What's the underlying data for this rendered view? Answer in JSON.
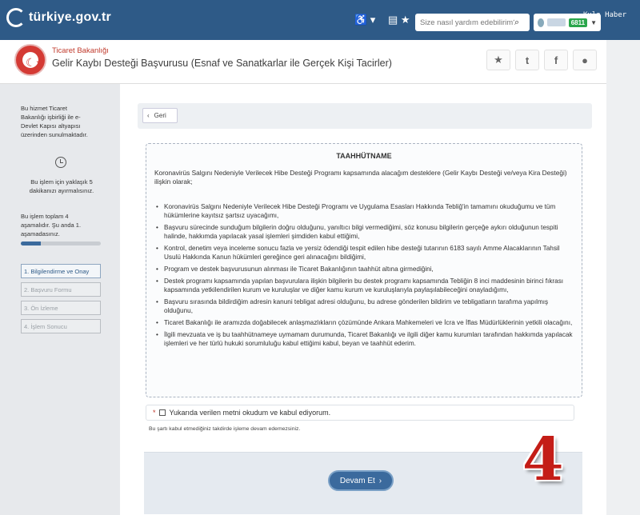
{
  "topbar": {
    "logo_text": "türkiye.gov.tr",
    "search_placeholder": "Size nasıl yardım edebilirim?",
    "user_badge": "6811",
    "watermark": "Kula Haber"
  },
  "service": {
    "department": "Ticaret Bakanlığı",
    "title": "Gelir Kaybı Desteği Başvurusu (Esnaf ve Sanatkarlar ile Gerçek Kişi Tacirler)"
  },
  "sidebar": {
    "provider_note": [
      "Bu hizmet Ticaret",
      "Bakanlığı işbirliği ile e-",
      "Devlet Kapısı altyapısı",
      "üzerinden sunulmaktadır."
    ],
    "time_note": [
      "Bu işlem için yaklaşık 5",
      "dakikanızı ayırmalısınız."
    ],
    "stage_note": [
      "Bu işlem toplam 4",
      "aşamalıdır. Şu anda 1.",
      "aşamadasınız."
    ],
    "progress_fraction": 0.25,
    "steps": [
      {
        "label": "1. Bilgilendirme ve Onay"
      },
      {
        "label": "2. Başvuru Formu"
      },
      {
        "label": "3. Ön İzleme"
      },
      {
        "label": "4. İşlem Sonucu"
      }
    ]
  },
  "main": {
    "back_label": "Geri",
    "pledge_title": "TAAHHÜTNAME",
    "pledge_intro": "Koronavirüs Salgını Nedeniyle Verilecek Hibe Desteği Programı kapsamında alacağım desteklere (Gelir Kaybı Desteği ve/veya Kira Desteği) ilişkin olarak;",
    "pledge_items": [
      "Koronavirüs Salgını Nedeniyle Verilecek Hibe Desteği Programı ve Uygulama Esasları Hakkında Tebliğ'in tamamını okuduğumu ve tüm hükümlerine kayıtsız şartsız uyacağımı,",
      "Başvuru sürecinde sunduğum bilgilerin doğru olduğunu, yanıltıcı bilgi vermediğimi, söz konusu bilgilerin gerçeğe aykırı olduğunun tespiti halinde, hakkımda yapılacak yasal işlemleri şimdiden kabul ettiğimi,",
      "Kontrol, denetim veya inceleme sonucu fazla ve yersiz ödendiği tespit edilen hibe desteği tutarının 6183 sayılı Amme Alacaklarının Tahsil Usulü Hakkında Kanun hükümleri gereğince geri alınacağını bildiğimi,",
      "Program ve destek başvurusunun alınması ile Ticaret Bakanlığının taahhüt altına girmediğini,",
      "Destek programı kapsamında yapılan başvurulara ilişkin bilgilerin bu destek programı kapsamında Tebliğin 8 inci maddesinin birinci fıkrası kapsamında yetkilendirilen kurum ve kuruluşlar ve diğer kamu kurum ve kuruluşlarıyla paylaşılabileceğini onayladığımı,",
      "Başvuru sırasında bildirdiğim adresin kanuni tebligat adresi olduğunu, bu adrese gönderilen bildirim ve tebligatların tarafıma yapılmış olduğunu,",
      "Ticaret Bakanlığı ile aramızda doğabilecek anlaşmazlıkların çözümünde Ankara Mahkemeleri ve İcra ve İflas Müdürlüklerinin yetkili olacağını,",
      "İlgili mevzuata ve iş bu taahhütnameye uymamam durumunda, Ticaret Bakanlığı ve ilgili diğer kamu kurumları tarafından hakkımda yapılacak işlemleri ve her türlü hukuki sorumluluğu kabul ettiğimi kabul, beyan ve taahhüt ederim."
    ],
    "agree_required": "*",
    "agree_label": "Yukarıda verilen metni okudum ve kabul ediyorum.",
    "warning": "Bu şartı kabul etmediğiniz takdirde işleme devam edemezsiniz.",
    "continue_label": "Devam Et"
  },
  "overlay": {
    "step_number": "4"
  },
  "colors": {
    "topbar": "#2e5a87",
    "accent": "#3b6a9d",
    "department": "#c0392b",
    "overlay_number": "#c41d17"
  }
}
